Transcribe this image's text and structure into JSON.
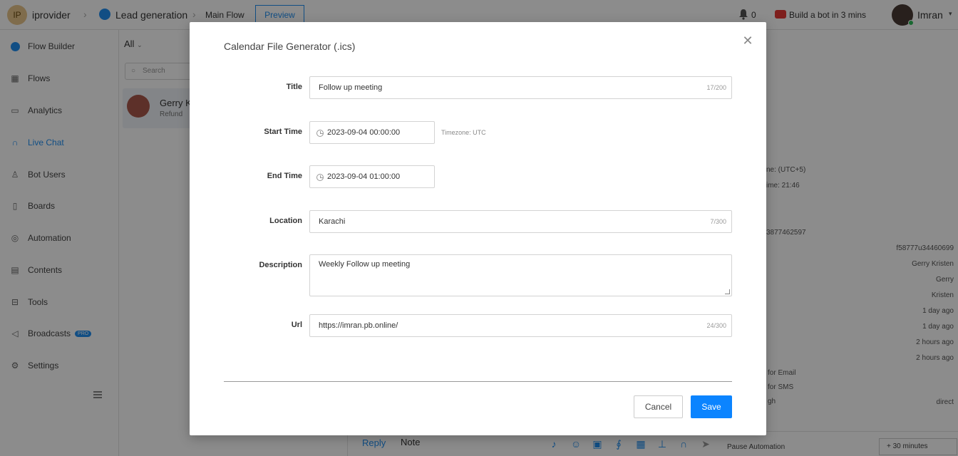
{
  "topbar": {
    "avatar_initials": "IP",
    "org_name": "iprovider",
    "breadcrumb_bot": "Lead generation",
    "breadcrumb_flow": "Main Flow",
    "preview_label": "Preview",
    "notification_count": "0",
    "build_bot_label": "Build a bot in 3 mins",
    "user_name": "Imran"
  },
  "sidebar": {
    "items": [
      {
        "label": "Flow Builder",
        "icon": "messenger-icon"
      },
      {
        "label": "Flows",
        "icon": "grid-icon"
      },
      {
        "label": "Analytics",
        "icon": "analytics-icon"
      },
      {
        "label": "Live Chat",
        "icon": "headset-icon"
      },
      {
        "label": "Bot Users",
        "icon": "user-icon"
      },
      {
        "label": "Boards",
        "icon": "board-icon"
      },
      {
        "label": "Automation",
        "icon": "automation-icon"
      },
      {
        "label": "Contents",
        "icon": "contents-icon"
      },
      {
        "label": "Tools",
        "icon": "tools-icon"
      },
      {
        "label": "Broadcasts",
        "icon": "megaphone-icon",
        "badge": "PRO"
      },
      {
        "label": "Settings",
        "icon": "gear-icon"
      }
    ]
  },
  "chatlist": {
    "filter_label": "All",
    "search_placeholder": "Search",
    "conversation": {
      "name": "Gerry K",
      "subtitle": "Refund"
    }
  },
  "rightpanel": {
    "lines": [
      "ne: (UTC+5)",
      "ime: 21:46",
      "3877462597"
    ],
    "values": [
      "f58777u34460699",
      "Gerry Kristen",
      "Gerry",
      "Kristen",
      "1 day ago",
      "1 day ago",
      "2 hours ago",
      "2 hours ago"
    ],
    "footer_lines": [
      "for Email",
      "for SMS",
      "gh"
    ],
    "direct_label": "direct"
  },
  "bottombar": {
    "reply_tab": "Reply",
    "note_tab": "Note",
    "pause_label": "Pause Automation",
    "pause_duration": "+ 30 minutes"
  },
  "modal": {
    "title": "Calendar File Generator (.ics)",
    "fields": {
      "title": {
        "label": "Title",
        "value": "Follow up meeting",
        "counter": "17/200"
      },
      "start_time": {
        "label": "Start Time",
        "value": "2023-09-04 00:00:00"
      },
      "timezone_note": "Timezone: UTC",
      "end_time": {
        "label": "End Time",
        "value": "2023-09-04 01:00:00"
      },
      "location": {
        "label": "Location",
        "value": "Karachi",
        "counter": "7/300"
      },
      "description": {
        "label": "Description",
        "value": "Weekly Follow up meeting"
      },
      "url": {
        "label": "Url",
        "value": "https://imran.pb.online/",
        "counter": "24/300"
      }
    },
    "cancel_label": "Cancel",
    "save_label": "Save"
  },
  "colors": {
    "accent": "#0b84ff",
    "link": "#1f8ef1",
    "overlay": "rgba(0,0,0,0.45)"
  }
}
